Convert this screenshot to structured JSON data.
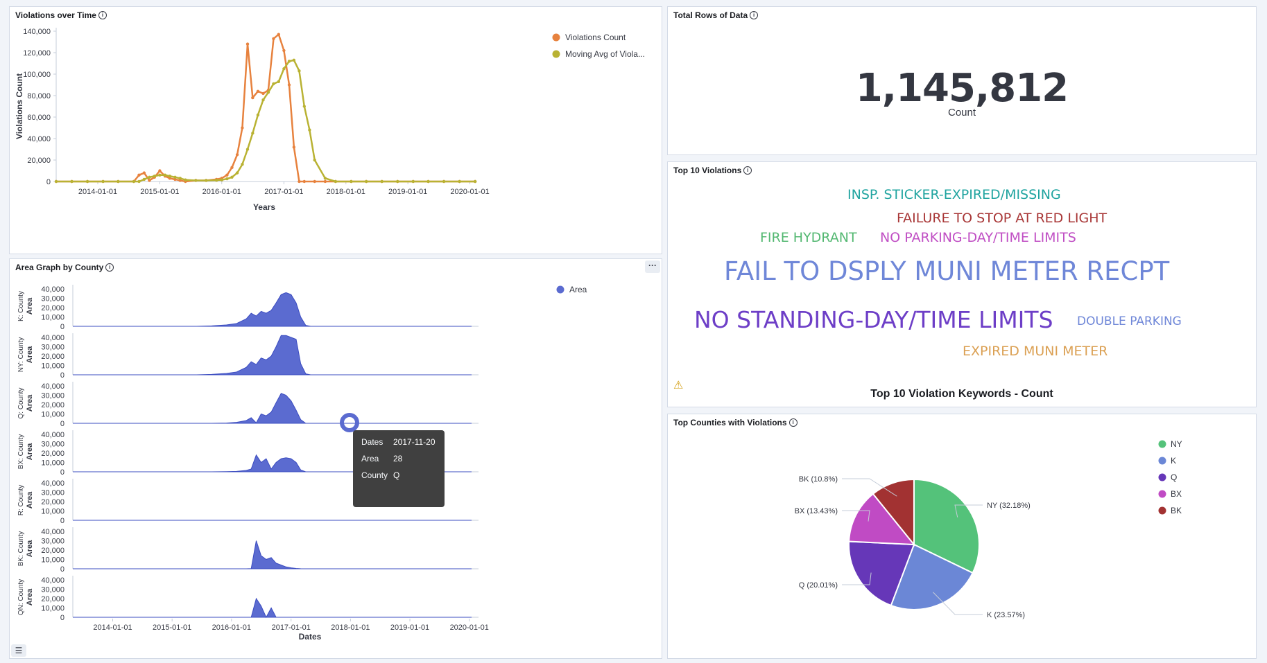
{
  "panels": {
    "violations_over_time": {
      "title": "Violations over Time"
    },
    "total_rows": {
      "title": "Total Rows of Data",
      "value": "1,145,812",
      "label": "Count"
    },
    "area_by_county": {
      "title": "Area Graph by County"
    },
    "top10": {
      "title": "Top 10 Violations",
      "subtitle": "Top 10 Violation Keywords - Count",
      "warning_icon": "warning-icon"
    },
    "top_counties": {
      "title": "Top Counties with Violations"
    }
  },
  "tooltip": {
    "rows": [
      {
        "key": "Dates",
        "value": "2017-11-20"
      },
      {
        "key": "Area",
        "value": "28"
      },
      {
        "key": "County",
        "value": "Q"
      }
    ]
  },
  "wordcloud": [
    {
      "text": "INSP. STICKER-EXPIRED/MISSING",
      "color": "#20a4a0"
    },
    {
      "text": "FAILURE TO STOP AT RED LIGHT",
      "color": "#a83636"
    },
    {
      "text": "FIRE HYDRANT",
      "color": "#54b872"
    },
    {
      "text": "NO PARKING-DAY/TIME LIMITS",
      "color": "#c04fc4"
    },
    {
      "text": "FAIL TO DSPLY MUNI METER RECPT",
      "color": "#6f87d8"
    },
    {
      "text": "NO STANDING-DAY/TIME LIMITS",
      "color": "#6d3ec7"
    },
    {
      "text": "DOUBLE PARKING",
      "color": "#6f87d8"
    },
    {
      "text": "EXPIRED MUNI METER",
      "color": "#dba053"
    }
  ],
  "chart_data": [
    {
      "type": "line",
      "xlabel": "Years",
      "ylabel": "Violations Count",
      "ylim": [
        0,
        140000
      ],
      "yticks": [
        "0",
        "20,000",
        "40,000",
        "60,000",
        "80,000",
        "100,000",
        "120,000",
        "140,000"
      ],
      "xticks": [
        "2014-01-01",
        "2015-01-01",
        "2016-01-01",
        "2017-01-01",
        "2018-01-01",
        "2019-01-01",
        "2020-01-01"
      ],
      "legend_position": "top-right",
      "series": [
        {
          "name": "Violations Count",
          "color": "#e7823e",
          "x": [
            "2013-05-01",
            "2013-08-01",
            "2013-11-01",
            "2014-02-01",
            "2014-05-01",
            "2014-08-01",
            "2014-09-01",
            "2014-10-01",
            "2014-11-01",
            "2014-12-01",
            "2015-01-01",
            "2015-02-01",
            "2015-03-01",
            "2015-04-01",
            "2015-05-01",
            "2015-06-01",
            "2015-08-01",
            "2015-10-01",
            "2015-12-01",
            "2016-01-01",
            "2016-02-01",
            "2016-03-01",
            "2016-04-01",
            "2016-05-01",
            "2016-06-01",
            "2016-07-01",
            "2016-08-01",
            "2016-09-01",
            "2016-10-01",
            "2016-11-01",
            "2016-12-01",
            "2017-01-01",
            "2017-02-01",
            "2017-03-01",
            "2017-04-01",
            "2017-05-01",
            "2017-07-01",
            "2017-09-01",
            "2017-11-01",
            "2018-02-01",
            "2018-05-01",
            "2018-08-01",
            "2018-11-01",
            "2019-02-01",
            "2019-05-01",
            "2019-08-01",
            "2019-11-01",
            "2020-02-01"
          ],
          "values": [
            0,
            0,
            0,
            0,
            0,
            0,
            6000,
            8000,
            1000,
            4000,
            10000,
            5000,
            3000,
            2000,
            1000,
            0,
            1000,
            1000,
            2000,
            3000,
            6000,
            13000,
            25000,
            50000,
            128000,
            78000,
            84000,
            82000,
            85000,
            133000,
            137000,
            122000,
            90000,
            32000,
            0,
            0,
            0,
            0,
            0,
            0,
            0,
            0,
            0,
            0,
            0,
            0,
            0,
            0
          ]
        },
        {
          "name": "Moving Avg of Viola...",
          "color": "#b9b233",
          "x": [
            "2013-05-01",
            "2013-08-01",
            "2013-11-01",
            "2014-02-01",
            "2014-05-01",
            "2014-08-01",
            "2014-09-01",
            "2014-10-01",
            "2014-11-01",
            "2014-12-01",
            "2015-01-01",
            "2015-02-01",
            "2015-03-01",
            "2015-04-01",
            "2015-05-01",
            "2015-06-01",
            "2015-08-01",
            "2015-10-01",
            "2015-12-01",
            "2016-01-01",
            "2016-02-01",
            "2016-03-01",
            "2016-04-01",
            "2016-05-01",
            "2016-06-01",
            "2016-07-01",
            "2016-08-01",
            "2016-09-01",
            "2016-10-01",
            "2016-11-01",
            "2016-12-01",
            "2017-01-01",
            "2017-02-01",
            "2017-03-01",
            "2017-04-01",
            "2017-05-01",
            "2017-06-01",
            "2017-07-01",
            "2017-09-01",
            "2017-11-01",
            "2018-02-01",
            "2018-05-01",
            "2018-08-01",
            "2018-11-01",
            "2019-02-01",
            "2019-05-01",
            "2019-08-01",
            "2019-11-01",
            "2020-02-01"
          ],
          "values": [
            0,
            0,
            0,
            0,
            0,
            0,
            0,
            2000,
            4000,
            5000,
            6000,
            6000,
            5000,
            4000,
            3000,
            1500,
            1000,
            1000,
            1200,
            1500,
            2500,
            4000,
            8000,
            16000,
            30000,
            45000,
            62000,
            76000,
            83000,
            91000,
            93000,
            105000,
            112000,
            113000,
            103000,
            70000,
            48000,
            20000,
            3000,
            0,
            0,
            0,
            0,
            0,
            0,
            0,
            0,
            0,
            0
          ]
        }
      ]
    },
    {
      "type": "area",
      "xlabel": "Dates",
      "ylabel": "Area",
      "legend": [
        "Area"
      ],
      "color": "#5b6bd0",
      "ylim": [
        0,
        40000
      ],
      "yticks": [
        "0",
        "10,000",
        "20,000",
        "30,000",
        "40,000"
      ],
      "xticks": [
        "2014-01-01",
        "2015-01-01",
        "2016-01-01",
        "2017-01-01",
        "2018-01-01",
        "2019-01-01",
        "2020-01-01"
      ],
      "x": [
        "2013-05-01",
        "2015-06-01",
        "2015-09-01",
        "2015-12-01",
        "2016-02-01",
        "2016-04-01",
        "2016-05-01",
        "2016-06-01",
        "2016-07-01",
        "2016-08-01",
        "2016-09-01",
        "2016-10-01",
        "2016-11-01",
        "2016-12-01",
        "2017-01-01",
        "2017-02-01",
        "2017-03-01",
        "2017-04-01",
        "2017-05-01",
        "2017-06-01",
        "2020-01-15"
      ],
      "series": [
        {
          "name": "K: County",
          "values": [
            0,
            0,
            500,
            1500,
            3000,
            8000,
            14000,
            11000,
            16000,
            14000,
            17000,
            25000,
            34000,
            36000,
            34000,
            25000,
            10000,
            1000,
            0,
            0,
            0
          ]
        },
        {
          "name": "NY: County",
          "values": [
            0,
            0,
            500,
            1500,
            3000,
            8000,
            14000,
            11000,
            18000,
            16000,
            20000,
            30000,
            42000,
            42000,
            40000,
            38000,
            12000,
            1000,
            0,
            0,
            0
          ]
        },
        {
          "name": "Q: County",
          "values": [
            0,
            0,
            0,
            300,
            1000,
            3000,
            6000,
            500,
            10000,
            8000,
            12000,
            22000,
            32000,
            30000,
            24000,
            14000,
            4000,
            0,
            0,
            0,
            0
          ]
        },
        {
          "name": "BX: County",
          "values": [
            0,
            0,
            0,
            200,
            500,
            1500,
            3000,
            18000,
            10000,
            14000,
            3000,
            10000,
            14000,
            15000,
            14000,
            10000,
            2000,
            0,
            0,
            0,
            0
          ]
        },
        {
          "name": "R: County",
          "values": [
            0,
            0,
            0,
            0,
            0,
            0,
            0,
            0,
            0,
            0,
            0,
            0,
            0,
            0,
            0,
            0,
            0,
            0,
            0,
            0,
            0
          ]
        },
        {
          "name": "BK: County",
          "values": [
            0,
            0,
            0,
            0,
            0,
            0,
            200,
            30000,
            14000,
            10000,
            12000,
            6000,
            4000,
            2000,
            1000,
            400,
            100,
            0,
            0,
            0,
            0
          ]
        },
        {
          "name": "QN: County",
          "values": [
            0,
            0,
            0,
            0,
            0,
            0,
            0,
            20000,
            12000,
            0,
            10000,
            0,
            0,
            0,
            0,
            0,
            0,
            0,
            0,
            0,
            0
          ]
        }
      ]
    },
    {
      "type": "pie",
      "legend_position": "right",
      "slices": [
        {
          "name": "NY",
          "pct": 32.18,
          "label": "NY (32.18%)",
          "color": "#54c27a"
        },
        {
          "name": "K",
          "pct": 23.57,
          "label": "K (23.57%)",
          "color": "#6b87d6"
        },
        {
          "name": "Q",
          "pct": 20.01,
          "label": "Q (20.01%)",
          "color": "#6637b8"
        },
        {
          "name": "BX",
          "pct": 13.43,
          "label": "BX (13.43%)",
          "color": "#c04bc4"
        },
        {
          "name": "BK",
          "pct": 10.8,
          "label": "BK (10.8%)",
          "color": "#a23232"
        }
      ]
    }
  ]
}
